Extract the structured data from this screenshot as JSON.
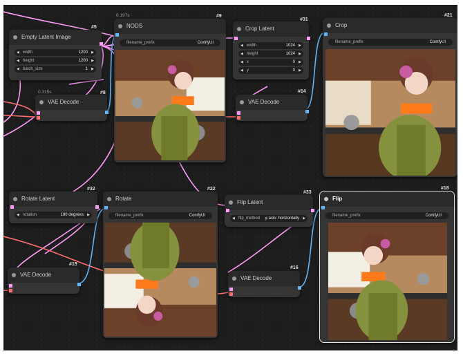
{
  "nodes": {
    "empty_latent": {
      "title": "Empty Latent Image",
      "id": "#5",
      "width_label": "width",
      "width_value": "1200",
      "height_label": "height",
      "height_value": "1200",
      "batch_label": "batch_size",
      "batch_value": "1"
    },
    "vae_decode_top": {
      "title": "VAE Decode",
      "id": "#8",
      "timing": "0.315s"
    },
    "nods": {
      "title": "NODS",
      "id": "#9",
      "timing": "0.197s",
      "fp_label": "filename_prefix",
      "fp_value": "ComfyUI"
    },
    "crop_latent": {
      "title": "Crop Latent",
      "id": "#31",
      "width_label": "width",
      "width_value": "1024",
      "height_label": "height",
      "height_value": "1024",
      "x_label": "x",
      "x_value": "0",
      "y_label": "y",
      "y_value": "0"
    },
    "vae_decode_crop": {
      "title": "VAE Decode",
      "id": "#14"
    },
    "crop": {
      "title": "Crop",
      "id": "#21",
      "fp_label": "filename_prefix",
      "fp_value": "ComfyUI"
    },
    "rotate_latent": {
      "title": "Rotate Latent",
      "id": "#32",
      "rot_label": "rotation",
      "rot_value": "180 degrees"
    },
    "vae_decode_rotate": {
      "title": "VAE Decode",
      "id": "#15"
    },
    "rotate": {
      "title": "Rotate",
      "id": "#22",
      "fp_label": "filename_prefix",
      "fp_value": "ComfyUI"
    },
    "flip_latent": {
      "title": "Flip Latent",
      "id": "#33",
      "flip_label": "flip_method",
      "flip_value": "y-axis: horizontally"
    },
    "vae_decode_flip": {
      "title": "VAE Decode",
      "id": "#16"
    },
    "flip": {
      "title": "Flip",
      "id": "#18",
      "fp_label": "filename_prefix",
      "fp_value": "ComfyUI"
    }
  },
  "colors": {
    "latent": "#ff9cf9",
    "vae": "#ff6e6e",
    "image": "#64b5f6",
    "canvas": "#1d1d1d",
    "node": "#353535"
  }
}
